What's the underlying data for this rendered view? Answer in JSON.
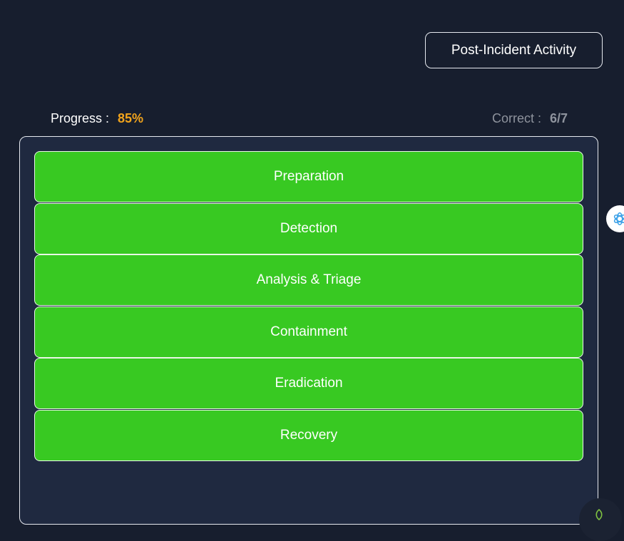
{
  "header": {
    "stage_button_label": "Post-Incident Activity"
  },
  "stats": {
    "progress_label": "Progress :",
    "progress_value": "85%",
    "correct_label": "Correct :",
    "correct_value": "6/7"
  },
  "stages": [
    {
      "label": "Preparation"
    },
    {
      "label": "Detection"
    },
    {
      "label": "Analysis & Triage"
    },
    {
      "label": "Containment"
    },
    {
      "label": "Eradication"
    },
    {
      "label": "Recovery"
    }
  ],
  "icons": {
    "assistant": "openai-logo-icon",
    "corner": "leaf-icon"
  },
  "colors": {
    "background": "#171e2e",
    "board": "#1f2940",
    "stage_correct": "#38c922",
    "progress_accent": "#f2a41c",
    "muted_text": "#8e939d",
    "assistant_icon": "#3aa0e8",
    "corner_icon": "#7fc241"
  }
}
